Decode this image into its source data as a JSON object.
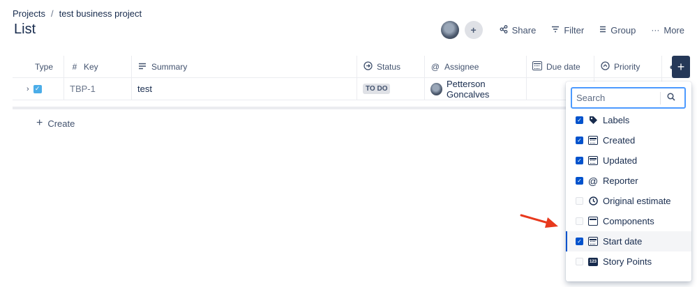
{
  "breadcrumb": {
    "root": "Projects",
    "separator": "/",
    "project": "test business project"
  },
  "page_title": "List",
  "toolbar": {
    "share": "Share",
    "filter": "Filter",
    "group": "Group",
    "more": "More"
  },
  "table": {
    "headers": {
      "type": "Type",
      "key": "Key",
      "summary": "Summary",
      "status": "Status",
      "assignee": "Assignee",
      "due_date": "Due date",
      "priority": "Priority"
    },
    "row": {
      "key": "TBP-1",
      "summary": "test",
      "status": "TO DO",
      "assignee": "Petterson Goncalves"
    }
  },
  "create_label": "Create",
  "column_picker": {
    "search_placeholder": "Search",
    "options": [
      {
        "label": "Labels",
        "checked": true,
        "icon": "tag-icon"
      },
      {
        "label": "Created",
        "checked": true,
        "icon": "calendar-icon"
      },
      {
        "label": "Updated",
        "checked": true,
        "icon": "calendar-icon"
      },
      {
        "label": "Reporter",
        "checked": true,
        "icon": "at-icon"
      },
      {
        "label": "Original estimate",
        "checked": false,
        "icon": "clock-icon"
      },
      {
        "label": "Components",
        "checked": false,
        "icon": "component-icon"
      },
      {
        "label": "Start date",
        "checked": true,
        "icon": "calendar-icon",
        "highlighted": true
      },
      {
        "label": "Story Points",
        "checked": false,
        "icon": "number-icon"
      }
    ]
  },
  "colors": {
    "accent": "#0052cc",
    "dark": "#253858",
    "arrow": "#e8391d",
    "issue_type": "#4bade8"
  }
}
